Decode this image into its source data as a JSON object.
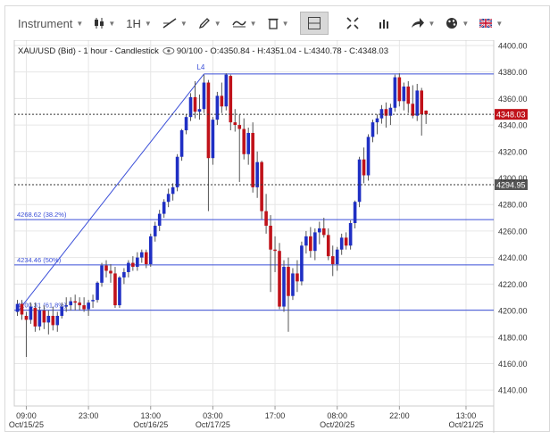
{
  "toolbar": {
    "instrument_label": "Instrument",
    "interval_label": "1H",
    "items": [
      {
        "name": "instrument-menu",
        "icon": "none"
      },
      {
        "name": "chart-type-menu",
        "icon": "candlestick-icon"
      },
      {
        "name": "interval-menu",
        "icon": "none"
      },
      {
        "name": "line-tool-menu",
        "icon": "trendline-icon"
      },
      {
        "name": "draw-tool-menu",
        "icon": "pencil-icon"
      },
      {
        "name": "indicator-menu",
        "icon": "wave-icon"
      },
      {
        "name": "delete-menu",
        "icon": "trash-icon"
      },
      {
        "name": "crosshair-toggle",
        "icon": "crosshair-icon"
      },
      {
        "name": "fullscreen-button",
        "icon": "expand-icon"
      },
      {
        "name": "volume-button",
        "icon": "bars-icon"
      },
      {
        "name": "share-menu",
        "icon": "share-arrow-icon"
      },
      {
        "name": "settings-menu",
        "icon": "palette-icon"
      },
      {
        "name": "language-menu",
        "icon": "flag-uk-icon"
      }
    ]
  },
  "colors": {
    "up": "#1f2fc4",
    "down": "#c0121a",
    "wick": "#555555",
    "drawing": "#3b4fd8",
    "grid": "#e6e6e6",
    "price_tag_bg": "#c0121a",
    "crosshair_tag_bg": "#555555"
  },
  "chart_data": {
    "type": "candlestick",
    "title": "XAU/USD (Bid) - 1 hour - Candlestick",
    "info": "90/100 - O:4350.84 - H:4351.04 - L:4340.78 - C:4348.03",
    "ylim": [
      4128,
      4404
    ],
    "y_ticks": [
      "4400.00",
      "4380.00",
      "4360.00",
      "4340.00",
      "4320.00",
      "4300.00",
      "4280.00",
      "4260.00",
      "4240.00",
      "4220.00",
      "4200.00",
      "4180.00",
      "4160.00",
      "4140.00"
    ],
    "x_ticks": [
      {
        "time": "09:00",
        "date": "Oct/15/25",
        "index": 2
      },
      {
        "time": "23:00",
        "date": "",
        "index": 16
      },
      {
        "time": "13:00",
        "date": "Oct/16/25",
        "index": 30
      },
      {
        "time": "03:00",
        "date": "Oct/17/25",
        "index": 44
      },
      {
        "time": "17:00",
        "date": "",
        "index": 58
      },
      {
        "time": "08:00",
        "date": "Oct/20/25",
        "index": 72
      },
      {
        "time": "22:00",
        "date": "",
        "index": 86
      },
      {
        "time": "13:00",
        "date": "Oct/21/25",
        "index": 101
      }
    ],
    "last_price_label": "4348.03",
    "last_price": 4348.03,
    "crosshair_price_label": "4294.95",
    "crosshair_price": 4294.95,
    "fibonacci": {
      "levels": [
        {
          "label": "4268.62 (38.2%)",
          "price": 4268.62
        },
        {
          "label": "4234.46 (50%)",
          "price": 4234.46
        },
        {
          "label": "4200.31 (61.8%)",
          "price": 4200.31
        }
      ],
      "top_label": "L4",
      "top_price": 4378.5,
      "low_price": 4199,
      "start_index": 0,
      "top_index": 42
    },
    "candles": [
      [
        4199,
        4208,
        4196,
        4205
      ],
      [
        4205,
        4208,
        4193,
        4197
      ],
      [
        4196,
        4199,
        4165,
        4193
      ],
      [
        4193,
        4206,
        4190,
        4203
      ],
      [
        4202,
        4206,
        4184,
        4188
      ],
      [
        4188,
        4203,
        4185,
        4200
      ],
      [
        4200,
        4204,
        4186,
        4191
      ],
      [
        4191,
        4200,
        4182,
        4196
      ],
      [
        4196,
        4203,
        4185,
        4189
      ],
      [
        4189,
        4199,
        4184,
        4196
      ],
      [
        4196,
        4206,
        4194,
        4203
      ],
      [
        4203,
        4210,
        4199,
        4204
      ],
      [
        4204,
        4210,
        4200,
        4207
      ],
      [
        4207,
        4212,
        4200,
        4206
      ],
      [
        4206,
        4210,
        4200,
        4204
      ],
      [
        4204,
        4210,
        4199,
        4201
      ],
      [
        4201,
        4208,
        4196,
        4206
      ],
      [
        4207,
        4212,
        4202,
        4208
      ],
      [
        4208,
        4222,
        4206,
        4221
      ],
      [
        4221,
        4236,
        4218,
        4234
      ],
      [
        4234,
        4238,
        4225,
        4230
      ],
      [
        4230,
        4235,
        4221,
        4228
      ],
      [
        4228,
        4233,
        4202,
        4204
      ],
      [
        4204,
        4226,
        4202,
        4225
      ],
      [
        4225,
        4232,
        4220,
        4229
      ],
      [
        4229,
        4238,
        4225,
        4236
      ],
      [
        4236,
        4241,
        4230,
        4233
      ],
      [
        4233,
        4244,
        4230,
        4240
      ],
      [
        4240,
        4246,
        4236,
        4244
      ],
      [
        4244,
        4246,
        4232,
        4235
      ],
      [
        4235,
        4258,
        4233,
        4256
      ],
      [
        4256,
        4267,
        4252,
        4264
      ],
      [
        4264,
        4276,
        4260,
        4273
      ],
      [
        4273,
        4284,
        4270,
        4282
      ],
      [
        4282,
        4292,
        4278,
        4288
      ],
      [
        4288,
        4296,
        4283,
        4293
      ],
      [
        4293,
        4318,
        4290,
        4316
      ],
      [
        4316,
        4337,
        4313,
        4336
      ],
      [
        4336,
        4348,
        4333,
        4346
      ],
      [
        4346,
        4364,
        4343,
        4361
      ],
      [
        4361,
        4373,
        4345,
        4350
      ],
      [
        4350,
        4363,
        4344,
        4352
      ],
      [
        4352,
        4378,
        4349,
        4372
      ],
      [
        4372,
        4374,
        4275,
        4315
      ],
      [
        4315,
        4346,
        4310,
        4344
      ],
      [
        4344,
        4365,
        4340,
        4362
      ],
      [
        4362,
        4372,
        4349,
        4354
      ],
      [
        4354,
        4379,
        4351,
        4378
      ],
      [
        4377,
        4378,
        4336,
        4342
      ],
      [
        4342,
        4352,
        4335,
        4340
      ],
      [
        4340,
        4348,
        4297,
        4337
      ],
      [
        4337,
        4345,
        4314,
        4318
      ],
      [
        4318,
        4338,
        4310,
        4334
      ],
      [
        4334,
        4342,
        4289,
        4293
      ],
      [
        4293,
        4320,
        4285,
        4312
      ],
      [
        4312,
        4313,
        4269,
        4275
      ],
      [
        4275,
        4288,
        4258,
        4264
      ],
      [
        4264,
        4272,
        4214,
        4246
      ],
      [
        4246,
        4256,
        4229,
        4245
      ],
      [
        4245,
        4251,
        4201,
        4203
      ],
      [
        4203,
        4238,
        4199,
        4233
      ],
      [
        4233,
        4240,
        4184,
        4211
      ],
      [
        4211,
        4232,
        4208,
        4228
      ],
      [
        4228,
        4238,
        4214,
        4222
      ],
      [
        4222,
        4252,
        4219,
        4249
      ],
      [
        4249,
        4260,
        4243,
        4256
      ],
      [
        4256,
        4263,
        4240,
        4245
      ],
      [
        4245,
        4262,
        4238,
        4259
      ],
      [
        4259,
        4267,
        4250,
        4262
      ],
      [
        4262,
        4270,
        4255,
        4257
      ],
      [
        4257,
        4262,
        4238,
        4241
      ],
      [
        4241,
        4249,
        4226,
        4235
      ],
      [
        4235,
        4248,
        4230,
        4246
      ],
      [
        4246,
        4258,
        4242,
        4255
      ],
      [
        4255,
        4259,
        4246,
        4249
      ],
      [
        4249,
        4268,
        4246,
        4266
      ],
      [
        4266,
        4283,
        4262,
        4282
      ],
      [
        4282,
        4316,
        4278,
        4314
      ],
      [
        4314,
        4323,
        4296,
        4302
      ],
      [
        4302,
        4333,
        4298,
        4331
      ],
      [
        4331,
        4344,
        4327,
        4342
      ],
      [
        4342,
        4348,
        4333,
        4345
      ],
      [
        4345,
        4355,
        4341,
        4352
      ],
      [
        4352,
        4357,
        4338,
        4347
      ],
      [
        4347,
        4356,
        4340,
        4353
      ],
      [
        4353,
        4378,
        4350,
        4376
      ],
      [
        4376,
        4379,
        4354,
        4358
      ],
      [
        4358,
        4372,
        4351,
        4369
      ],
      [
        4369,
        4373,
        4349,
        4356
      ],
      [
        4356,
        4370,
        4345,
        4347
      ],
      [
        4347,
        4371,
        4343,
        4366
      ],
      [
        4366,
        4368,
        4332,
        4348
      ],
      [
        4350.84,
        4351.04,
        4340.78,
        4348.03
      ]
    ]
  }
}
